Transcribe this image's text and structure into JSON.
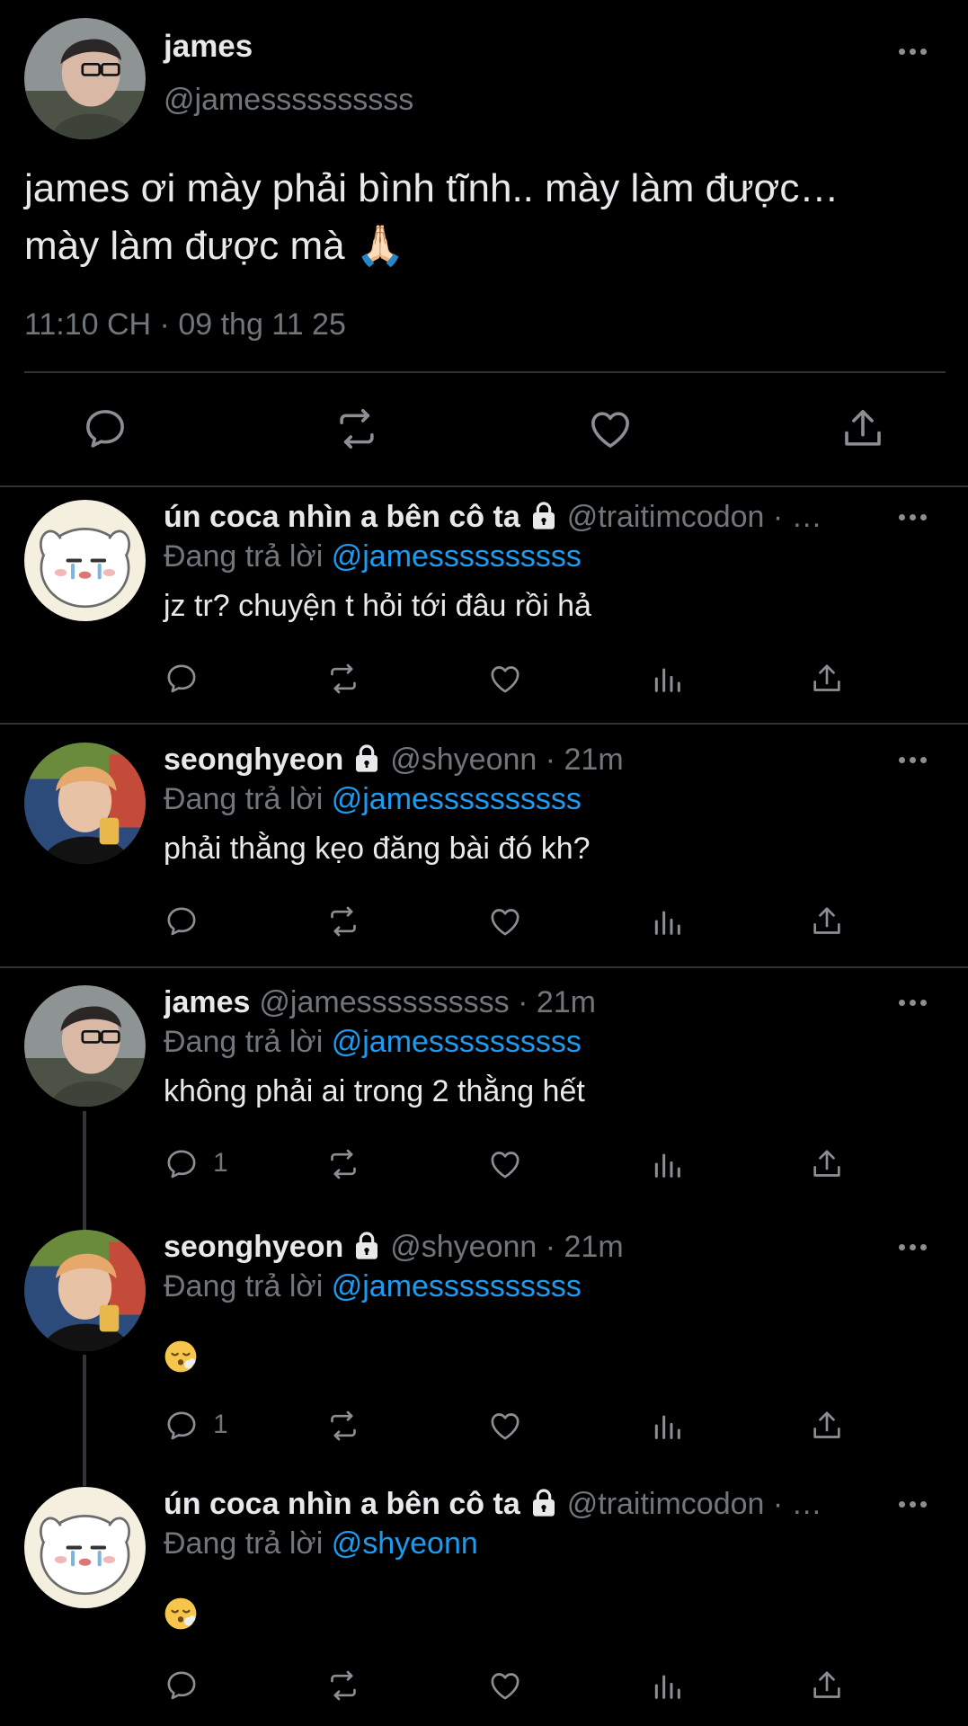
{
  "main_tweet": {
    "name": "james",
    "handle": "@jamessssssssss",
    "text_line1": "james ơi mày phải bình tĩnh.. mày làm được…",
    "text_line2": "mày làm được mà",
    "text_emoji": "🙏🏻",
    "time": "11:10 CH · 09 thg 11 25",
    "icons": [
      "reply-icon",
      "retweet-icon",
      "like-icon",
      "share-icon"
    ]
  },
  "replying_label": "Đang trả lời",
  "replies": [
    {
      "name": "ún coca nhìn a bên cô ta",
      "locked": true,
      "handle": "@traitimcodon",
      "time": " · …",
      "replying_to": "@jamessssssssss",
      "text": "jz tr? chuyện t hỏi tới đâu rồi hả",
      "reply_count": ""
    },
    {
      "name": "seonghyeon",
      "locked": true,
      "handle": "@shyeonn",
      "time": " · 21m",
      "replying_to": "@jamessssssssss",
      "text": "phải thằng kẹo đăng bài đó kh?",
      "reply_count": ""
    },
    {
      "name": "james",
      "locked": false,
      "handle": "@jamessssssssss",
      "time": " · 21m",
      "replying_to": "@jamessssssssss",
      "text": "không phải ai trong 2 thằng hết",
      "reply_count": "1"
    },
    {
      "name": "seonghyeon",
      "locked": true,
      "handle": "@shyeonn",
      "time": " · 21m",
      "replying_to": "@jamessssssssss",
      "text": "",
      "emoji": "face-exhaling-emoji",
      "reply_count": "1"
    },
    {
      "name": "ún coca nhìn a bên cô ta",
      "locked": true,
      "handle": "@traitimcodon",
      "time": " · …",
      "replying_to": "@shyeonn",
      "text": "",
      "emoji": "face-exhaling-emoji",
      "reply_count": ""
    }
  ],
  "colors": {
    "background": "#000000",
    "text": "#e7e9ea",
    "secondary": "#71767b",
    "mention": "#1d9bf0",
    "divider": "#2f3336"
  }
}
